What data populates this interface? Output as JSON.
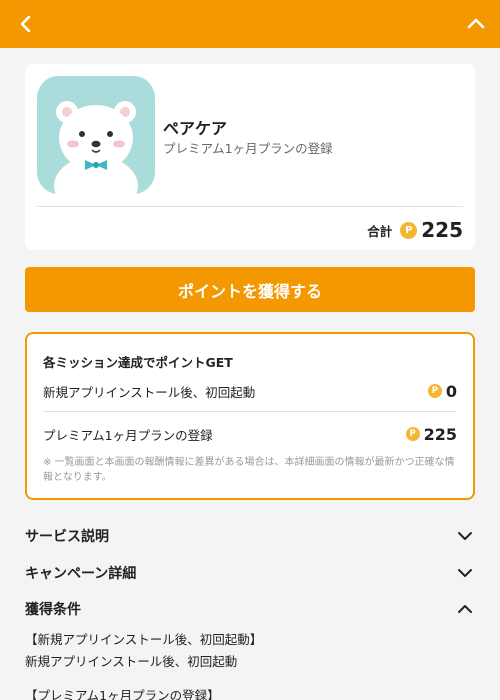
{
  "app": {
    "name": "ペアケア",
    "plan": "プレミアム1ヶ月プランの登録",
    "total_label": "合計",
    "total_value": "225",
    "coin_symbol": "P"
  },
  "cta": {
    "label": "ポイントを獲得する"
  },
  "missions": {
    "title": "各ミッション達成でポイントGET",
    "items": [
      {
        "label": "新規アプリインストール後、初回起動",
        "points": "0"
      },
      {
        "label": "プレミアム1ヶ月プランの登録",
        "points": "225"
      }
    ],
    "note": "※ 一覧画面と本画面の報酬情報に差異がある場合は、本詳細画面の情報が最新かつ正確な情報となります。"
  },
  "sections": [
    {
      "title": "サービス説明",
      "expanded": false
    },
    {
      "title": "キャンペーン詳細",
      "expanded": false
    },
    {
      "title": "獲得条件",
      "expanded": true
    }
  ],
  "conditions": [
    "【新規アプリインストール後、初回起動】",
    "新規アプリインストール後、初回起動",
    "【プレミアム1ヶ月プランの登録】"
  ],
  "colors": {
    "accent": "#f39800",
    "coin": "#f5b731",
    "icon_bg": "#a9dcdb"
  }
}
